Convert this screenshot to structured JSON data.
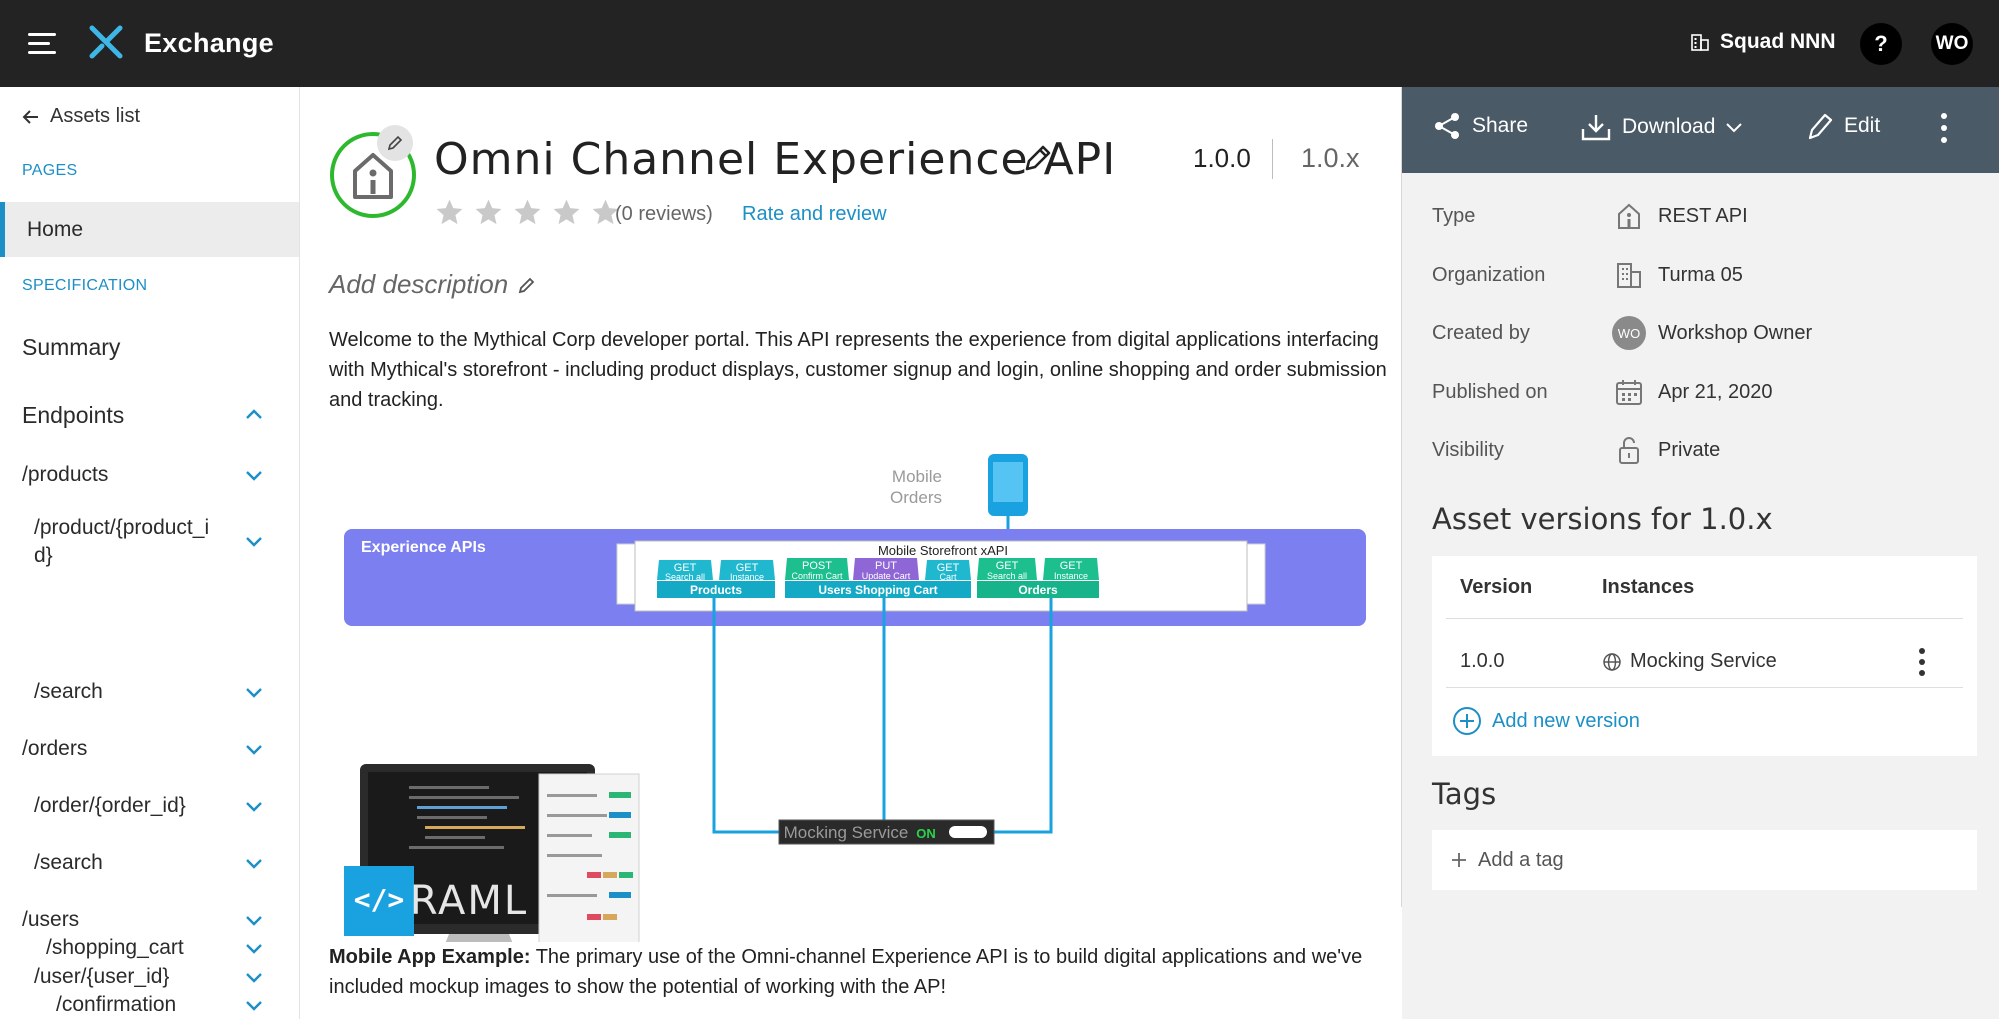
{
  "topbar": {
    "app_title": "Exchange",
    "org_name": "Squad NNN",
    "help_label": "?",
    "user_initials": "WO"
  },
  "sidebar": {
    "back_label": "Assets list",
    "pages_label": "PAGES",
    "home_label": "Home",
    "spec_label": "SPECIFICATION",
    "summary_label": "Summary",
    "endpoints_label": "Endpoints",
    "endpoints": [
      {
        "label": "/products"
      },
      {
        "label": "/product/{product_i"
      },
      {
        "label": "d}"
      },
      {
        "label": "/search"
      },
      {
        "label": "/orders"
      },
      {
        "label": "/order/{order_id}"
      },
      {
        "label": "/search"
      },
      {
        "label": "/users"
      },
      {
        "label": "/user/{user_id}"
      },
      {
        "label": "/shopping_cart"
      },
      {
        "label": "/confirmation"
      }
    ]
  },
  "asset": {
    "title": "Omni Channel Experience API",
    "version": "1.0.0",
    "version_minor": "1.0.x",
    "reviews": "(0 reviews)",
    "rate_label": "Rate and review",
    "rating": 0,
    "add_description": "Add description",
    "description": "Welcome to the Mythical Corp developer portal. This API represents the experience from digital applications interfacing with Mythical's storefront - including product displays, customer signup and login, online shopping and order submission and tracking.",
    "footer_bold": "Mobile App Example:",
    "footer_text": " The primary use of the Omni-channel Experience API is to build digital applications and we've included mockup images to show the potential of working with the AP!"
  },
  "diagram": {
    "mobile_label_1": "Mobile",
    "mobile_label_2": "Orders",
    "experience_label": "Experience APIs",
    "storefront_label": "Mobile Storefront xAPI",
    "groups": [
      "Products",
      "Users Shopping Cart",
      "Orders"
    ],
    "methods": [
      {
        "verb": "GET",
        "desc": "Search all"
      },
      {
        "verb": "GET",
        "desc": "Instance"
      },
      {
        "verb": "POST",
        "desc": "Confirm Cart"
      },
      {
        "verb": "PUT",
        "desc": "Update Cart"
      },
      {
        "verb": "GET",
        "desc": "Cart"
      },
      {
        "verb": "GET",
        "desc": "Search all"
      },
      {
        "verb": "GET",
        "desc": "Instance"
      }
    ],
    "mocking_label": "Mocking Service",
    "mocking_state": "ON",
    "raml_label": "RAML",
    "raml_code_icon": "</>"
  },
  "right_panel": {
    "actions": {
      "share": "Share",
      "download": "Download",
      "edit": "Edit"
    },
    "meta": [
      {
        "key": "Type",
        "value": "REST API",
        "icon": "api-icon"
      },
      {
        "key": "Organization",
        "value": "Turma 05",
        "icon": "building-icon"
      },
      {
        "key": "Created by",
        "value": "Workshop Owner",
        "icon": "avatar",
        "initials": "WO"
      },
      {
        "key": "Published on",
        "value": "Apr 21, 2020",
        "icon": "calendar-icon"
      },
      {
        "key": "Visibility",
        "value": "Private",
        "icon": "lock-icon"
      }
    ],
    "versions_title": "Asset versions for 1.0.x",
    "versions_headers": [
      "Version",
      "Instances"
    ],
    "versions_rows": [
      {
        "version": "1.0.0",
        "instance": "Mocking Service"
      }
    ],
    "add_version": "Add new version",
    "tags_title": "Tags",
    "add_tag": "Add a tag"
  },
  "colors": {
    "topbar": "#232323",
    "accent": "#1c8fc7",
    "actions_bar": "#4a5a66",
    "experience_band": "#7b7ff0",
    "method_teal": "#1fb8cf",
    "method_green": "#1dbf8f",
    "method_purple": "#8f66d6"
  }
}
